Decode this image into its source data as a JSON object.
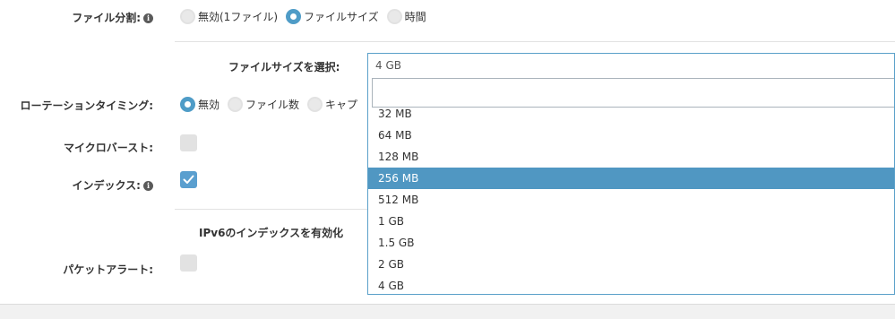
{
  "file_split": {
    "label": "ファイル分割:",
    "options": [
      {
        "label": "無効(1ファイル)",
        "checked": false
      },
      {
        "label": "ファイルサイズ",
        "checked": true
      },
      {
        "label": "時間",
        "checked": false
      }
    ]
  },
  "file_size": {
    "label": "ファイルサイズを選択:",
    "selected_value": "4 GB",
    "search_value": "",
    "options": [
      {
        "label": "32 MB",
        "highlighted": false
      },
      {
        "label": "64 MB",
        "highlighted": false
      },
      {
        "label": "128 MB",
        "highlighted": false
      },
      {
        "label": "256 MB",
        "highlighted": true
      },
      {
        "label": "512 MB",
        "highlighted": false
      },
      {
        "label": "1 GB",
        "highlighted": false
      },
      {
        "label": "1.5 GB",
        "highlighted": false
      },
      {
        "label": "2 GB",
        "highlighted": false
      },
      {
        "label": "4 GB",
        "highlighted": false
      }
    ]
  },
  "rotation_timing": {
    "label": "ローテーションタイミング:",
    "options": [
      {
        "label": "無効",
        "checked": true
      },
      {
        "label": "ファイル数",
        "checked": false
      },
      {
        "label": "キャプ",
        "checked": false
      }
    ]
  },
  "microburst": {
    "label": "マイクロバースト:",
    "checked": false
  },
  "index": {
    "label": "インデックス:",
    "checked": true
  },
  "ipv6_index": {
    "label": "IPv6のインデックスを有効化"
  },
  "packet_alert": {
    "label": "パケットアラート:",
    "checked": false
  },
  "icons": {
    "info": "info-icon",
    "check": "check-icon"
  },
  "colors": {
    "accent": "#4f9cc7",
    "highlight": "#5097c2",
    "border": "#5aa0c9"
  }
}
